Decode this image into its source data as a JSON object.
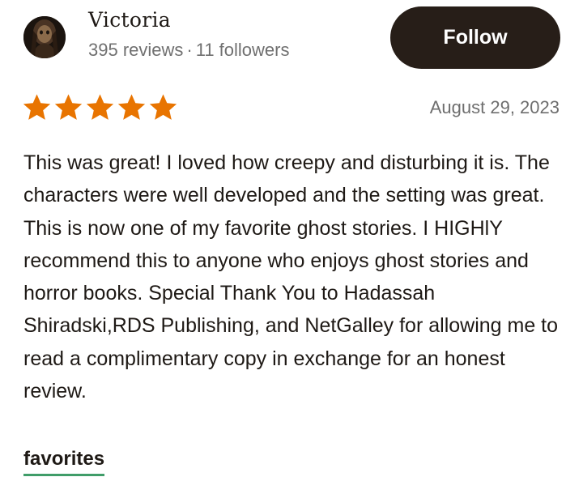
{
  "reviewer": {
    "name": "Victoria",
    "reviews_count": "395 reviews",
    "separator": "·",
    "followers_count": "11 followers"
  },
  "follow_button": {
    "label": "Follow"
  },
  "review": {
    "rating": 5,
    "rating_max": 5,
    "date": "August 29, 2023",
    "text": "This was great! I loved how creepy and disturbing it is. The characters were well developed and the setting was great. This is now one of my favorite ghost stories. I HIGHlY recommend this to anyone who enjoys ghost stories and horror books. Special Thank You to Hadassah Shiradski,RDS Publishing, and NetGalley for allowing me to read a complimentary copy in exchange for an honest review."
  },
  "shelf": {
    "label": "favorites"
  },
  "icons": {
    "star": "star-icon",
    "avatar": "user-avatar-image"
  },
  "colors": {
    "star": "#e87400",
    "button_bg": "#271e18",
    "button_text": "#ffffff",
    "text_primary": "#1e1915",
    "text_secondary": "#707070",
    "shelf_underline": "#409d69"
  }
}
